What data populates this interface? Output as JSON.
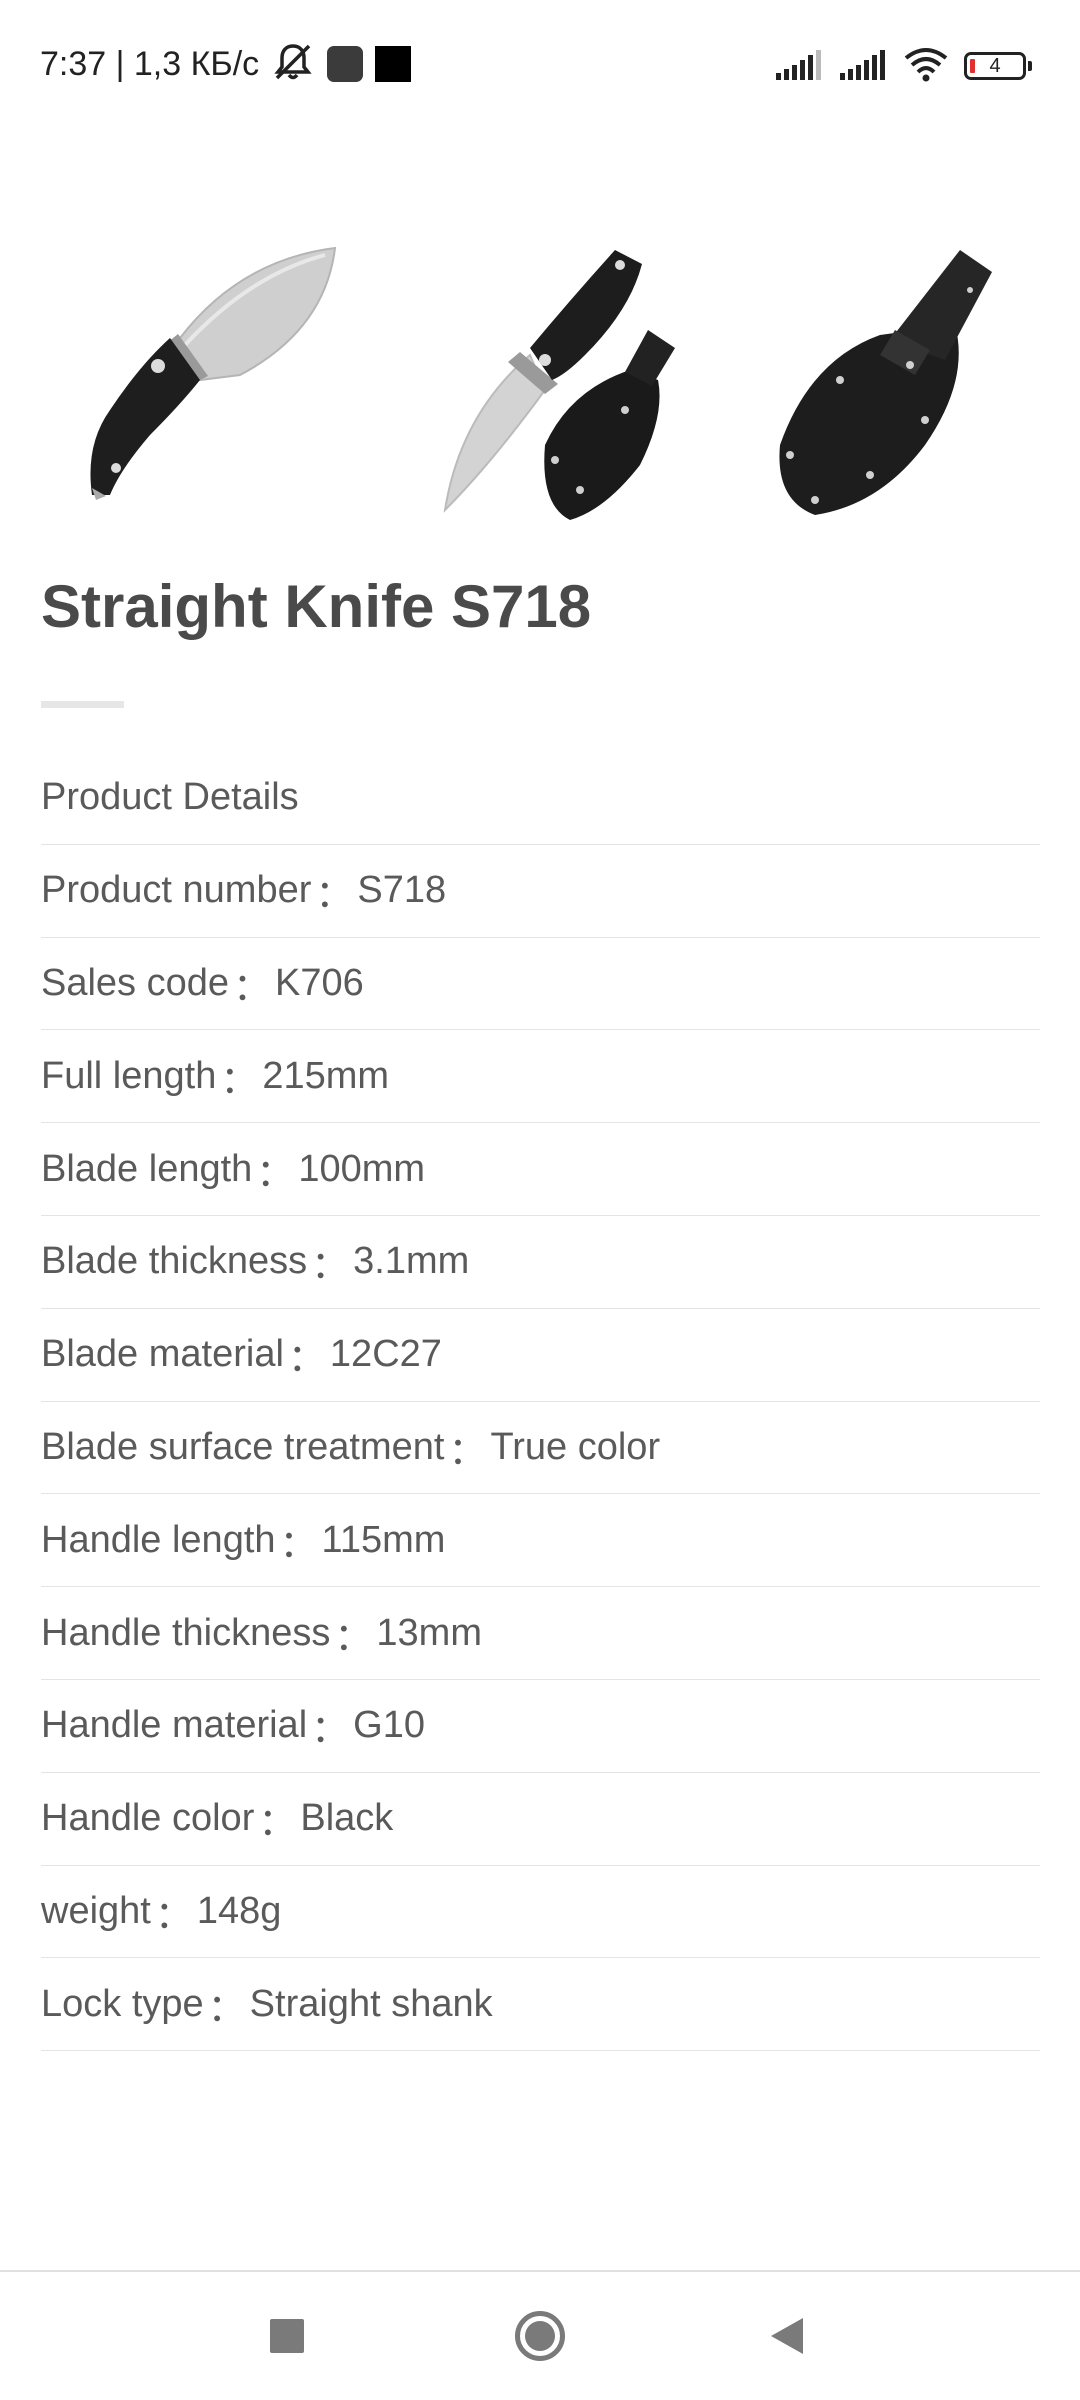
{
  "status_bar": {
    "time_and_speed": "7:37 | 1,3 КБ/с",
    "battery_level": "4",
    "icons": [
      "muted-bell-icon",
      "app-notification-icon",
      "app-notification-icon",
      "signal-icon",
      "signal-icon",
      "wifi-icon",
      "battery-icon"
    ]
  },
  "product": {
    "images": [
      {
        "alt": "knife"
      },
      {
        "alt": "knife with sheath"
      },
      {
        "alt": "sheath"
      }
    ],
    "title": "Straight Knife S718"
  },
  "specs": {
    "heading": "Product Details",
    "rows": [
      {
        "label": "Product number",
        "value": "S718"
      },
      {
        "label": "Sales code",
        "value": "K706"
      },
      {
        "label": "Full length",
        "value": "215mm"
      },
      {
        "label": "Blade length",
        "value": "100mm"
      },
      {
        "label": "Blade thickness",
        "value": "3.1mm"
      },
      {
        "label": "Blade material",
        "value": "12C27"
      },
      {
        "label": "Blade surface treatment",
        "value": "True color"
      },
      {
        "label": "Handle length",
        "value": "115mm"
      },
      {
        "label": "Handle thickness",
        "value": "13mm"
      },
      {
        "label": "Handle material",
        "value": "G10"
      },
      {
        "label": "Handle color",
        "value": "Black"
      },
      {
        "label": "weight",
        "value": "148g"
      },
      {
        "label": "Lock type",
        "value": "Straight shank"
      }
    ],
    "separator": "："
  },
  "nav_bar": {
    "buttons": [
      "recents-button",
      "home-button",
      "back-button"
    ]
  }
}
